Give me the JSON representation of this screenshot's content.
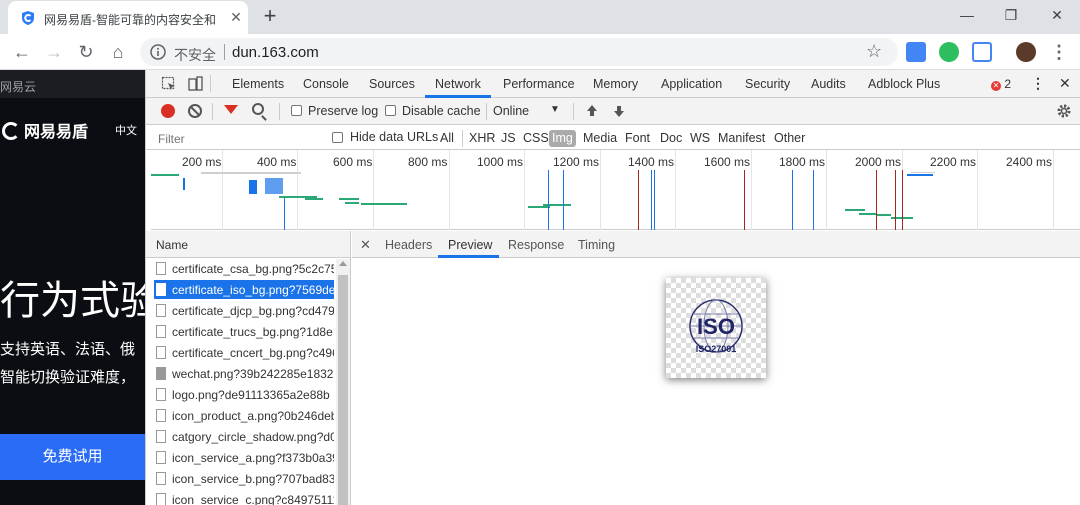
{
  "browser": {
    "tab_title": "网易易盾-智能可靠的内容安全和",
    "url": "dun.163.com",
    "insecure_label": "不安全"
  },
  "webpage": {
    "topbar": "网易云",
    "brand": "网易易盾",
    "lang": "中文",
    "hero": "行为式验",
    "sub1": "支持英语、法语、俄",
    "sub2": "智能切换验证难度，",
    "cta": "免费试用"
  },
  "devtools": {
    "tabs": [
      "Elements",
      "Console",
      "Sources",
      "Network",
      "Performance",
      "Memory",
      "Application",
      "Security",
      "Audits",
      "Adblock Plus"
    ],
    "active_tab": "Network",
    "error_count": "2",
    "preserve_log": "Preserve log",
    "disable_cache": "Disable cache",
    "throttle": "Online",
    "filter_placeholder": "Filter",
    "hide_data_urls": "Hide data URLs",
    "types": [
      "All",
      "XHR",
      "JS",
      "CSS",
      "Img",
      "Media",
      "Font",
      "Doc",
      "WS",
      "Manifest",
      "Other"
    ],
    "active_type": "Img",
    "timeline_ticks": [
      "200 ms",
      "400 ms",
      "600 ms",
      "800 ms",
      "1000 ms",
      "1200 ms",
      "1400 ms",
      "1600 ms",
      "1800 ms",
      "2000 ms",
      "2200 ms",
      "2400 ms"
    ],
    "name_header": "Name",
    "requests": [
      "certificate_csa_bg.png?5c2c75",
      "certificate_iso_bg.png?7569de",
      "certificate_djcp_bg.png?cd479",
      "certificate_trucs_bg.png?1d8e",
      "certificate_cncert_bg.png?c496",
      "wechat.png?39b242285e1832",
      "logo.png?de91113365a2e88b",
      "icon_product_a.png?0b246deb",
      "catgory_circle_shadow.png?d0",
      "icon_service_a.png?f373b0a39",
      "icon_service_b.png?707bad83",
      "icon_service_c.png?c84975111"
    ],
    "selected_request": "certificate_iso_bg.png?7569de",
    "detail_tabs": [
      "Headers",
      "Preview",
      "Response",
      "Timing"
    ],
    "active_detail_tab": "Preview",
    "preview": {
      "logo_text": "ISO",
      "logo_subtext": "ISO27001"
    }
  }
}
